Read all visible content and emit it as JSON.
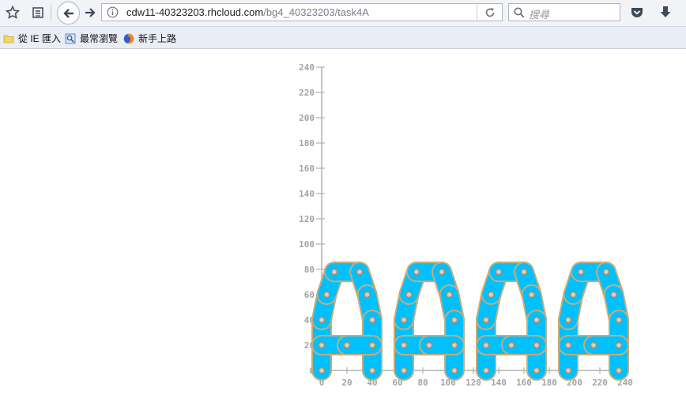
{
  "browser": {
    "url_host": "cdw11-40323203.rhcloud.com",
    "url_path": "/bg4_40323203/task4A",
    "search_placeholder": "搜尋",
    "icons": [
      "bookmark-star-icon",
      "reading-list-icon",
      "back-icon",
      "forward-icon",
      "info-icon",
      "reload-icon",
      "search-icon",
      "pocket-icon",
      "downloads-icon"
    ]
  },
  "bookmarks": [
    {
      "label": "從 IE 匯入",
      "icon": "folder-icon"
    },
    {
      "label": "最常瀏覽",
      "icon": "most-visited-icon"
    },
    {
      "label": "新手上路",
      "icon": "firefox-icon"
    }
  ],
  "chart_data": {
    "type": "scatter",
    "title": "",
    "xlabel": "",
    "ylabel": "",
    "xlim": [
      0,
      240
    ],
    "ylim": [
      0,
      240
    ],
    "x_ticks": [
      0,
      20,
      40,
      60,
      80,
      100,
      120,
      140,
      160,
      180,
      200,
      220,
      240
    ],
    "y_ticks": [
      0,
      20,
      40,
      60,
      80,
      100,
      120,
      140,
      160,
      180,
      200,
      220,
      240
    ],
    "colors": {
      "link_fill": "#00c0ff",
      "link_stroke": "#c4ad7a",
      "axis": "#b0b0b0"
    },
    "description_of_marks": "chain links forming four letter A shapes",
    "letter_offsets": [
      0,
      65,
      130,
      195
    ],
    "chain_pivots_per_letter": [
      [
        0,
        0
      ],
      [
        0,
        40
      ],
      [
        4,
        60
      ],
      [
        10,
        78
      ],
      [
        30,
        78
      ],
      [
        36,
        60
      ],
      [
        40,
        40
      ],
      [
        40,
        20
      ],
      [
        40,
        0
      ],
      [
        0,
        20
      ],
      [
        20,
        20
      ],
      [
        40,
        20
      ]
    ]
  }
}
